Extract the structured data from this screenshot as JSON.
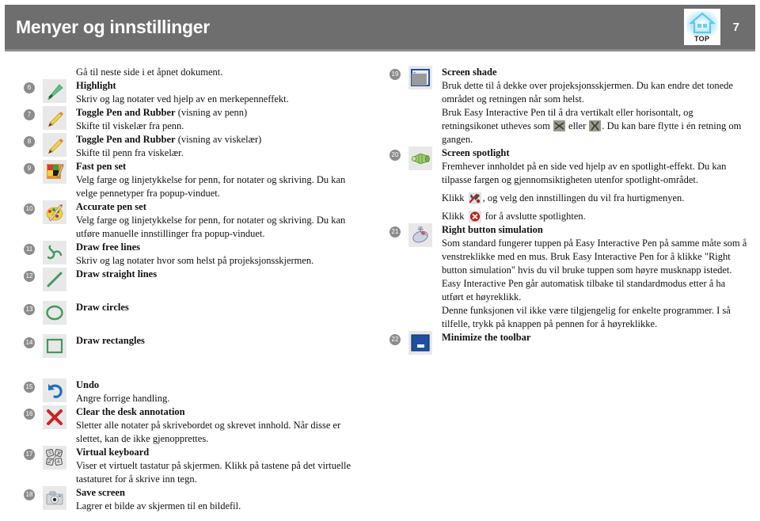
{
  "header": {
    "title": "Menyer og innstillinger",
    "page_number": "7",
    "logo_label": "TOP",
    "bar_color": "#6e6e6e",
    "title_color": "#ffffff"
  },
  "left_column": {
    "lead_text": "Gå til neste side i et åpnet dokument.",
    "items": [
      {
        "number": "6",
        "icon": "highlighter-icon",
        "title": "Highlight",
        "title_suffix": "",
        "lines": [
          "Skriv og lag notater ved hjelp av en merkepenneffekt."
        ]
      },
      {
        "number": "7",
        "icon": "pencil-icon",
        "title": "Toggle Pen and Rubber",
        "title_suffix": " (visning av penn)",
        "lines": [
          "Skifte til viskelær fra penn."
        ]
      },
      {
        "number": "8",
        "icon": "pencil-icon",
        "title": "Toggle Pen and Rubber",
        "title_suffix": " (visning av viskelær)",
        "lines": [
          "Skifte til penn fra viskelær."
        ]
      },
      {
        "number": "9",
        "icon": "fast-pen-set-icon",
        "title": "Fast pen set",
        "title_suffix": "",
        "lines": [
          "Velg farge og linjetykkelse for penn, for notater og skriving. Du kan velge pennetyper fra popup-vinduet."
        ]
      },
      {
        "number": "10",
        "icon": "accurate-pen-set-icon",
        "title": "Accurate pen set",
        "title_suffix": "",
        "lines": [
          "Velg farge og linjetykkelse for penn, for notater og skriving. Du kan utføre manuelle innstillinger fra popup-vinduet."
        ]
      },
      {
        "number": "11",
        "icon": "draw-free-lines-icon",
        "title": "Draw free lines",
        "title_suffix": "",
        "lines": [
          "Skriv og lag notater hvor som helst på projeksjonsskjermen."
        ]
      },
      {
        "number": "12",
        "icon": "draw-straight-lines-icon",
        "title": "Draw straight lines",
        "title_suffix": "",
        "lines": []
      },
      {
        "number": "13",
        "icon": "draw-circles-icon",
        "title": "Draw circles",
        "title_suffix": "",
        "lines": []
      },
      {
        "number": "14",
        "icon": "draw-rectangles-icon",
        "title": "Draw rectangles",
        "title_suffix": "",
        "lines": []
      }
    ],
    "items_lower": [
      {
        "number": "15",
        "icon": "undo-icon",
        "title": "Undo",
        "title_suffix": "",
        "lines": [
          "Angre forrige handling."
        ]
      },
      {
        "number": "16",
        "icon": "clear-annotation-icon",
        "title": "Clear the desk annotation",
        "title_suffix": "",
        "lines": [
          "Sletter alle notater på skrivebordet og skrevet innhold. Når disse er slettet, kan de ikke gjenopprettes."
        ]
      },
      {
        "number": "17",
        "icon": "virtual-keyboard-icon",
        "title": "Virtual keyboard",
        "title_suffix": "",
        "lines": [
          "Viser et virtuelt tastatur på skjermen. Klikk på tastene på det virtuelle tastaturet for å skrive inn tegn."
        ]
      },
      {
        "number": "18",
        "icon": "save-screen-icon",
        "title": "Save screen",
        "title_suffix": "",
        "lines": [
          "Lagrer et bilde av skjermen til en bildefil."
        ]
      }
    ]
  },
  "right_column": {
    "items": [
      {
        "number": "19",
        "icon": "screen-shade-icon",
        "title": "Screen shade",
        "title_suffix": "",
        "para1": "Bruk dette til å dekke over projeksjonsskjermen. Du kan endre det tonede området og retningen når som helst.",
        "para2_a": "Bruk Easy Interactive Pen til å dra vertikalt eller horisontalt, og retningsikonet utheves som ",
        "para2_mid": " eller ",
        "para2_b": ". Du kan bare flytte i én retning om gangen.",
        "inline_icon_1": "shade-horizontal-icon",
        "inline_icon_2": "shade-vertical-icon"
      },
      {
        "number": "20",
        "icon": "spotlight-icon",
        "title": "Screen spotlight",
        "title_suffix": "",
        "para1": "Fremhever innholdet på en side ved hjelp av en spotlight-effekt. Du kan tilpasse fargen og gjennomsiktigheten utenfor spotlight-området.",
        "para2_a": "Klikk ",
        "para2_b": ", og velg den innstillingen du vil fra hurtigmenyen.",
        "para3_a": "Klikk ",
        "para3_b": " for å avslutte spotlighten.",
        "inline_icon_1": "tools-icon",
        "inline_icon_2": "close-red-icon"
      },
      {
        "number": "21",
        "icon": "mouse-icon",
        "title": "Right button simulation",
        "title_suffix": "",
        "para1": "Som standard fungerer tuppen på Easy Interactive Pen på samme måte som å venstreklikke med en mus. Bruk Easy Interactive Pen for å klikke \"Right button simulation\" hvis du vil bruke tuppen som høyre musknapp istedet. Easy Interactive Pen går automatisk tilbake til standardmodus etter å ha utført et høyreklikk.",
        "para2": "Denne funksjonen vil ikke være tilgjengelig for enkelte programmer. I så tilfelle, trykk på knappen på pennen for å høyreklikke."
      },
      {
        "number": "22",
        "icon": "minimize-toolbar-icon",
        "title": "Minimize the toolbar",
        "title_suffix": "",
        "para1": ""
      }
    ]
  }
}
